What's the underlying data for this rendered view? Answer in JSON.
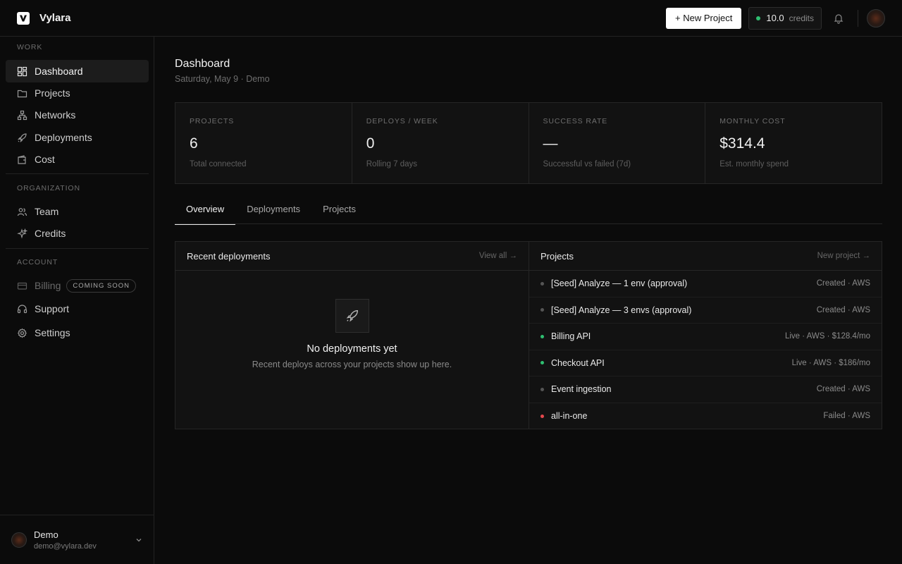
{
  "app": {
    "name": "Vylara"
  },
  "header": {
    "new_project_label": "+ New Project",
    "credits_value": "10.0",
    "credits_label": "credits"
  },
  "sidebar": {
    "sections": {
      "work": "WORK",
      "organization": "ORGANIZATION",
      "account": "ACCOUNT"
    },
    "items": {
      "dashboard": "Dashboard",
      "projects": "Projects",
      "networks": "Networks",
      "deployments": "Deployments",
      "cost": "Cost",
      "team": "Team",
      "credits": "Credits",
      "billing": "Billing",
      "billing_badge": "COMING SOON",
      "support": "Support",
      "settings": "Settings"
    },
    "user": {
      "name": "Demo",
      "email": "demo@vylara.dev"
    }
  },
  "page": {
    "title": "Dashboard",
    "subtitle": "Saturday, May 9 · Demo"
  },
  "stats": [
    {
      "label": "PROJECTS",
      "value": "6",
      "sub": "Total connected"
    },
    {
      "label": "DEPLOYS / WEEK",
      "value": "0",
      "sub": "Rolling 7 days"
    },
    {
      "label": "SUCCESS RATE",
      "value": "—",
      "sub": "Successful vs failed (7d)"
    },
    {
      "label": "MONTHLY COST",
      "value": "$314.4",
      "sub": "Est. monthly spend"
    }
  ],
  "tabs": [
    "Overview",
    "Deployments",
    "Projects"
  ],
  "recent": {
    "title": "Recent deployments",
    "link": "View all →",
    "empty_title": "No deployments yet",
    "empty_sub": "Recent deploys across your projects show up here."
  },
  "projects_panel": {
    "title": "Projects",
    "link": "New project →",
    "rows": [
      {
        "name": "[Seed] Analyze — 1 env (approval)",
        "meta": "Created · AWS",
        "status_color": "#555555"
      },
      {
        "name": "[Seed] Analyze — 3 envs (approval)",
        "meta": "Created · AWS",
        "status_color": "#555555"
      },
      {
        "name": "Billing API",
        "meta": "Live · AWS · $128.4/mo",
        "status_color": "#2fbf71"
      },
      {
        "name": "Checkout API",
        "meta": "Live · AWS · $186/mo",
        "status_color": "#2fbf71"
      },
      {
        "name": "Event ingestion",
        "meta": "Created · AWS",
        "status_color": "#555555"
      },
      {
        "name": "all-in-one",
        "meta": "Failed · AWS",
        "status_color": "#e5484d"
      }
    ]
  }
}
